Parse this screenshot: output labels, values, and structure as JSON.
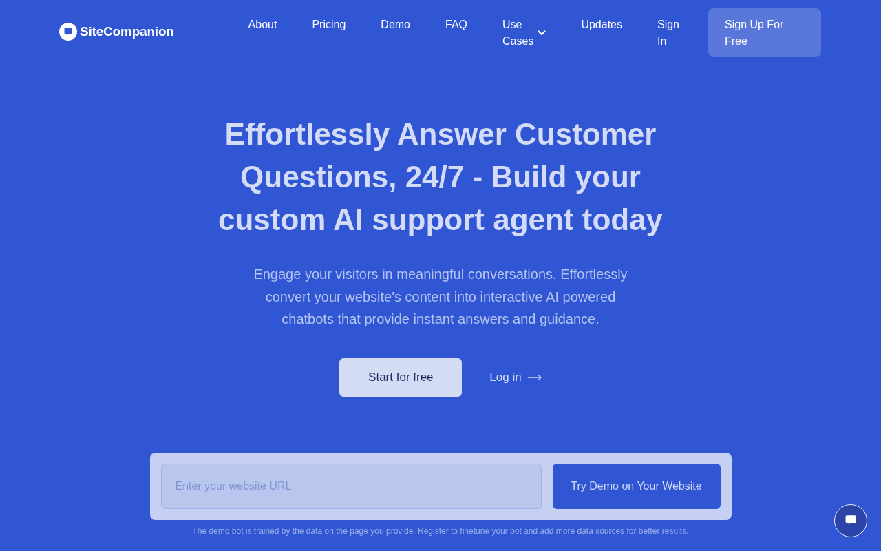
{
  "header": {
    "logo": {
      "text": "SiteCompanion"
    },
    "nav": [
      {
        "label": "About",
        "kind": "link"
      },
      {
        "label": "Pricing",
        "kind": "link"
      },
      {
        "label": "Demo",
        "kind": "link"
      },
      {
        "label": "FAQ",
        "kind": "link"
      },
      {
        "label": "Use Cases",
        "kind": "dropdown"
      },
      {
        "label": "Updates",
        "kind": "link"
      },
      {
        "label": "Sign In",
        "kind": "link"
      }
    ],
    "cta": "Sign Up For Free"
  },
  "hero": {
    "title": "Effortlessly Answer Customer Questions, 24/7 - Build your custom AI support agent today",
    "subtitle": "Engage your visitors in meaningful conversations. Effortlessly convert your website's content into interactive AI powered chatbots that provide instant answers and guidance.",
    "primary_button": "Start for free",
    "secondary_link": "Log in"
  },
  "demo_form": {
    "placeholder": "Enter your website URL",
    "button": "Try Demo on Your Website",
    "note": "The demo bot is trained by the data on the page you provide. Register to finetune your bot and add more data sources for better results."
  }
}
